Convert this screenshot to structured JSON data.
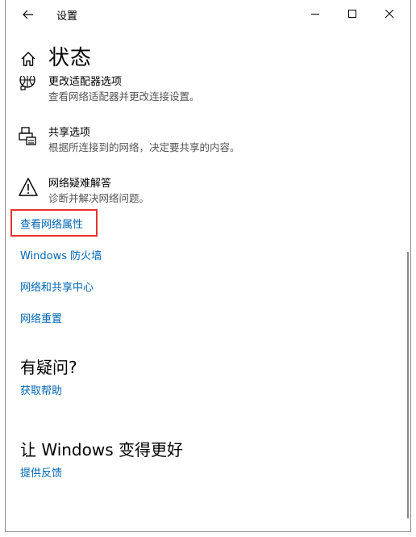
{
  "window": {
    "title": "设置"
  },
  "page": {
    "title": "状态"
  },
  "options": [
    {
      "title": "更改适配器选项",
      "desc": "查看网络适配器并更改连接设置。",
      "icon": "network-adapter-icon"
    },
    {
      "title": "共享选项",
      "desc": "根据所连接到的网络，决定要共享的内容。",
      "icon": "sharing-printer-icon"
    },
    {
      "title": "网络疑难解答",
      "desc": "诊断并解决网络问题。",
      "icon": "warning-icon"
    }
  ],
  "links": {
    "view_properties": "查看网络属性",
    "firewall": "Windows 防火墙",
    "sharing_center": "网络和共享中心",
    "reset": "网络重置"
  },
  "help": {
    "heading": "有疑问?",
    "link": "获取帮助"
  },
  "feedback": {
    "heading": "让 Windows 变得更好",
    "link": "提供反馈"
  },
  "colors": {
    "link": "#0066b4",
    "highlight": "#e8322d"
  }
}
